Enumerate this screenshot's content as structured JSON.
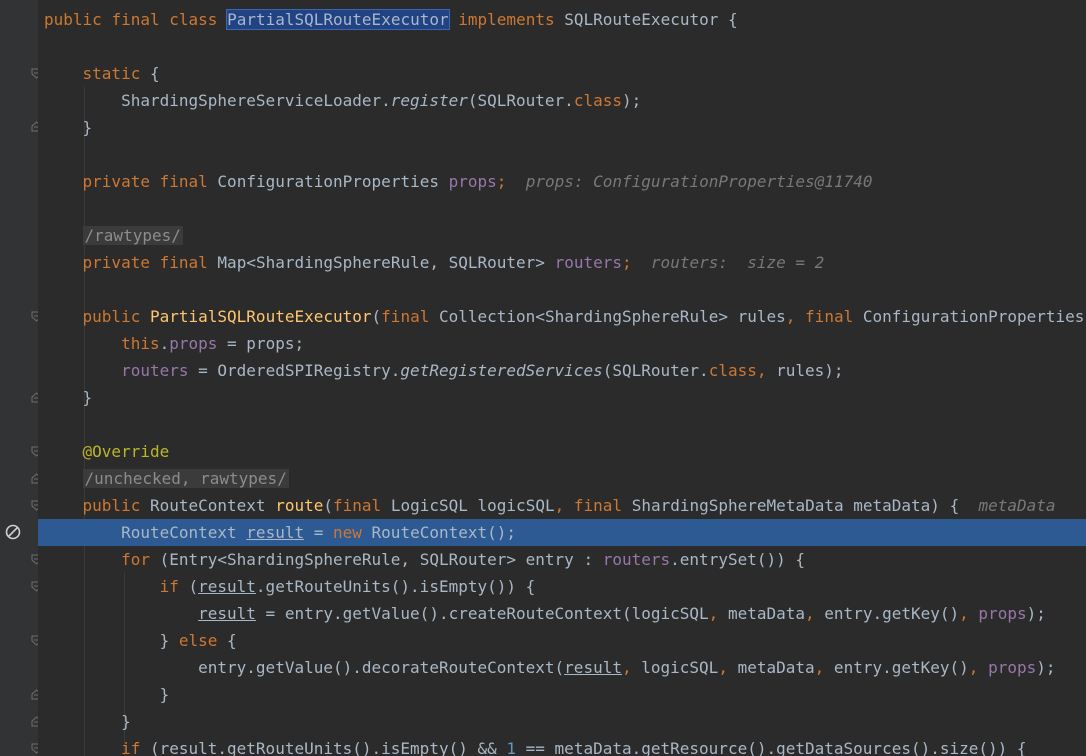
{
  "code": {
    "class_decl": {
      "kw1": "public",
      "kw2": "final",
      "kw3": "class",
      "name": "PartialSQLRouteExecutor",
      "kw4": "implements",
      "iface": "SQLRouteExecutor",
      "brace": "{"
    },
    "static_block": {
      "kw": "static",
      "brace": "{",
      "close": "}"
    },
    "register_line": {
      "cls": "ShardingSphereServiceLoader.",
      "method": "register",
      "open": "(SQLRouter.",
      "kw": "class",
      "close": ");"
    },
    "props_field": {
      "kw1": "private",
      "kw2": "final",
      "type": "ConfigurationProperties",
      "name": "props",
      "semi": ";",
      "hint": "props: ConfigurationProperties@11740"
    },
    "suppress1": "/rawtypes/",
    "routers_field": {
      "kw1": "private",
      "kw2": "final",
      "type": "Map<ShardingSphereRule, SQLRouter>",
      "name": "routers",
      "semi": ";",
      "hint": "routers:  size = 2"
    },
    "ctor": {
      "kw1": "public",
      "name": "PartialSQLRouteExecutor",
      "open": "(",
      "kw2": "final",
      "p1": "Collection<ShardingSphereRule> rules",
      "comma": ",",
      "kw3": "final",
      "p2": "ConfigurationProperties props) {"
    },
    "ctor_body1": {
      "kw": "this",
      "dot": ".",
      "field": "props",
      "rest": " = props;"
    },
    "ctor_body2": {
      "field": "routers",
      "mid": " = OrderedSPIRegistry.",
      "method": "getRegisteredServices",
      "open": "(SQLRouter.",
      "kw": "class",
      "comma": ",",
      "rest": " rules);"
    },
    "ctor_close": "}",
    "override": "@Override",
    "suppress2": "/unchecked, rawtypes/",
    "route_decl": {
      "kw1": "public",
      "type": "RouteContext",
      "name": "route",
      "open": "(",
      "kw2": "final",
      "p1": "LogicSQL logicSQL",
      "comma": ",",
      "kw3": "final",
      "p2": "ShardingSphereMetaData metaData) {",
      "hint": "metaData"
    },
    "result_line": {
      "type": "RouteContext ",
      "var": "result",
      "eq": " = ",
      "kw": "new",
      "rest": " RouteContext();"
    },
    "for_line": {
      "kw": "for",
      "mid": " (Entry<ShardingSphereRule, SQLRouter> entry : ",
      "field": "routers",
      "rest": ".entrySet()) {"
    },
    "if_line": {
      "kw": "if",
      "open": " (",
      "var": "result",
      "rest": ".getRouteUnits().isEmpty()) {"
    },
    "assign_line": {
      "var": "result",
      "mid": " = entry.getValue().createRouteContext(logicSQL",
      "c1": ",",
      "m2": " metaData",
      "c2": ",",
      "m3": " entry.getKey()",
      "c3": ",",
      "field": " props",
      "rest": ");"
    },
    "else_line": {
      "open": "} ",
      "kw": "else",
      "rest": " {"
    },
    "decorate_line": {
      "pre": "entry.getValue().decorateRouteContext(",
      "var": "result",
      "c1": ",",
      "m2": " logicSQL",
      "c2": ",",
      "m3": " metaData",
      "c3": ",",
      "m4": " entry.getKey()",
      "c4": ",",
      "field": " props",
      "rest": ");"
    },
    "close_inner": "}",
    "close_for": "}",
    "last_line": {
      "kw": "if",
      "pre": " (result.getRouteUnits().isEmpty() && ",
      "num": "1",
      "rest": " == metaData.getResource().getDataSources().size()) {"
    }
  },
  "colors": {
    "background": "#2b2b2b",
    "gutter": "#313335",
    "keyword": "#cc7832",
    "method": "#ffc66d",
    "field": "#9876aa",
    "annotation": "#bbb529",
    "execution_line": "#2d5a92"
  },
  "icons": [
    "fold-marker-icon",
    "fold-end-icon",
    "breakpoint-disabled-icon"
  ]
}
